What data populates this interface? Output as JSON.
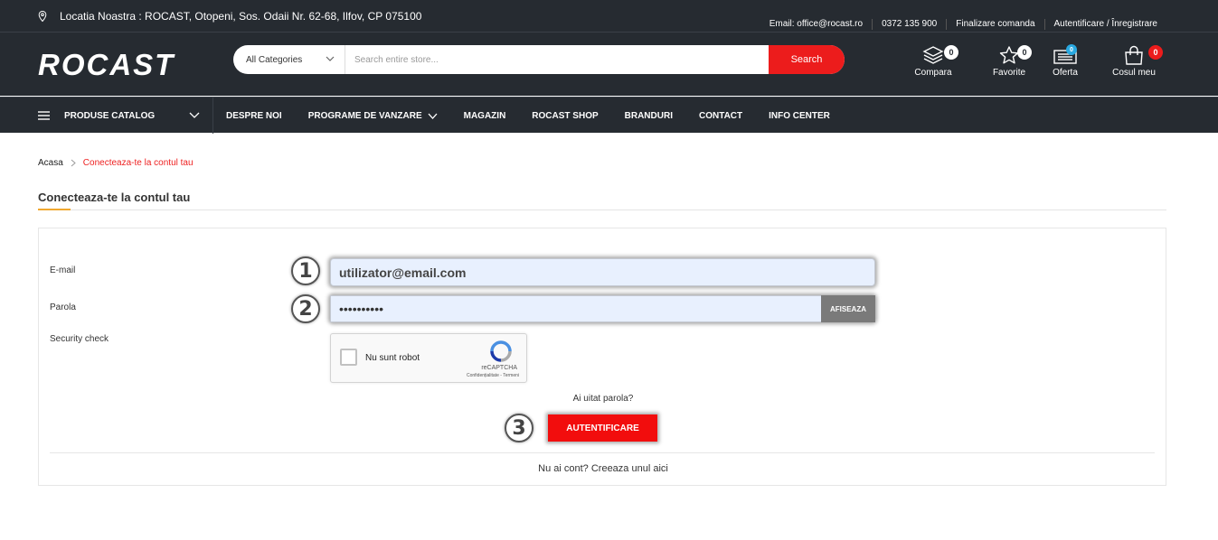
{
  "topbar": {
    "location": "Locatia Noastra : ROCAST, Otopeni, Sos. Odaii Nr. 62-68, Ilfov, CP 075100",
    "links": [
      "Email: office@rocast.ro",
      "0372 135 900",
      "Finalizare comanda",
      "Autentificare / Înregistrare"
    ]
  },
  "header": {
    "logo": "ROCAST",
    "category": "All Categories",
    "search_placeholder": "Search entire store...",
    "search_label": "Search",
    "icons": [
      {
        "label": "Compara",
        "count": "0",
        "icon": "layers-icon"
      },
      {
        "label": "Favorite",
        "count": "0",
        "icon": "star-icon"
      },
      {
        "label": "Oferta",
        "count": "0",
        "icon": "list-icon"
      },
      {
        "label": "Cosul meu",
        "count": "0",
        "icon": "bag-icon"
      }
    ],
    "badge_colors": {
      "dark": "#ffffff",
      "oferta": "#29a9e1",
      "cart": "#ec1c1c"
    }
  },
  "nav": {
    "catalog": "PRODUSE CATALOG",
    "items": [
      "DESPRE NOI",
      "PROGRAME DE VANZARE",
      "MAGAZIN",
      "ROCAST SHOP",
      "BRANDURI",
      "CONTACT",
      "INFO CENTER"
    ]
  },
  "breadcrumb": {
    "home": "Acasa",
    "current": "Conecteaza-te la contul tau"
  },
  "page_title": "Conecteaza-te la contul tau",
  "form": {
    "email_label": "E-mail",
    "email_value": "utilizator@email.com",
    "password_label": "Parola",
    "password_value": "••••••••••",
    "show_label": "AFISEAZA",
    "security_label": "Security check",
    "captcha_text": "Nu sunt robot",
    "captcha_brand": "reCAPTCHA",
    "captcha_terms": "Confidențialitate - Termeni",
    "forgot": "Ai uitat parola?",
    "submit": "AUTENTIFICARE",
    "register": "Nu ai cont? Creeaza unul aici"
  },
  "markers": [
    "1",
    "2",
    "3"
  ],
  "colors": {
    "accent": "#ec1c1c",
    "dark": "#262b31"
  }
}
